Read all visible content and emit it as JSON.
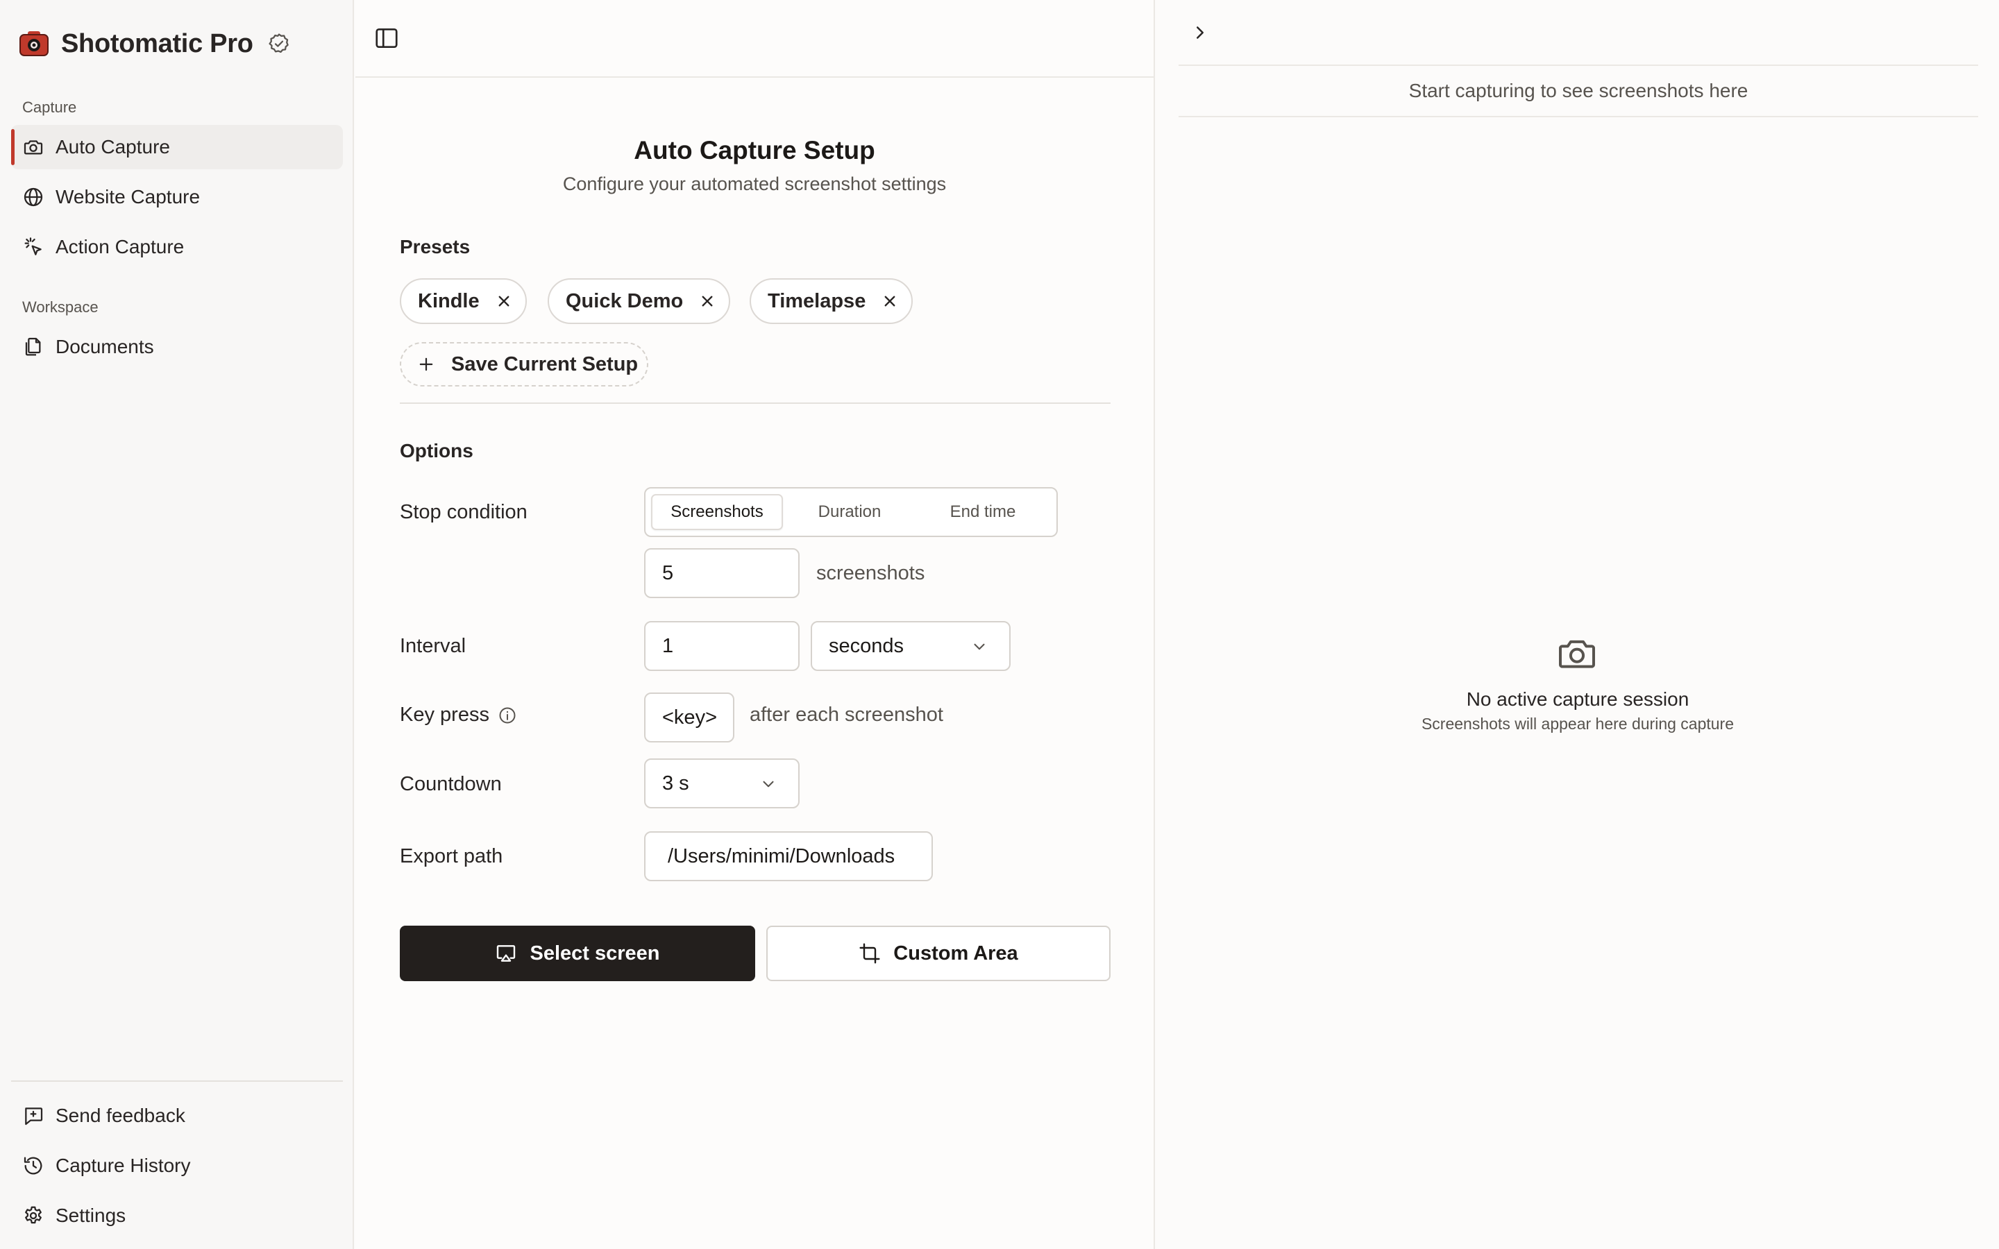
{
  "app": {
    "name": "Shotomatic Pro",
    "brand_color": "#c0392b"
  },
  "sidebar": {
    "capture_label": "Capture",
    "capture_items": [
      {
        "label": "Auto Capture",
        "icon": "camera-icon",
        "active": true
      },
      {
        "label": "Website Capture",
        "icon": "globe-icon"
      },
      {
        "label": "Action Capture",
        "icon": "pointer-click-icon"
      }
    ],
    "workspace_label": "Workspace",
    "workspace_items": [
      {
        "label": "Documents",
        "icon": "documents-icon"
      }
    ],
    "footer_items": [
      {
        "label": "Send feedback",
        "icon": "feedback-icon"
      },
      {
        "label": "Capture History",
        "icon": "history-icon"
      },
      {
        "label": "Settings",
        "icon": "gear-icon"
      }
    ]
  },
  "setup": {
    "title": "Auto Capture Setup",
    "subtitle": "Configure your automated screenshot settings",
    "presets_title": "Presets",
    "presets": [
      "Kindle",
      "Quick Demo",
      "Timelapse"
    ],
    "save_setup_label": "Save Current Setup",
    "options_title": "Options",
    "stop_condition": {
      "label": "Stop condition",
      "options": [
        "Screenshots",
        "Duration",
        "End time"
      ],
      "selected": "Screenshots",
      "count_value": "5",
      "count_unit": "screenshots"
    },
    "interval": {
      "label": "Interval",
      "value": "1",
      "unit": "seconds"
    },
    "key_press": {
      "label": "Key press",
      "key": "<key>",
      "suffix": "after each screenshot"
    },
    "countdown": {
      "label": "Countdown",
      "value": "3 s"
    },
    "export_path": {
      "label": "Export path",
      "value": "/Users/minimi/Downloads"
    },
    "select_screen_label": "Select screen",
    "custom_area_label": "Custom Area"
  },
  "preview": {
    "hint": "Start capturing to see screenshots here",
    "empty_title": "No active capture session",
    "empty_subtitle": "Screenshots will appear here during capture"
  }
}
